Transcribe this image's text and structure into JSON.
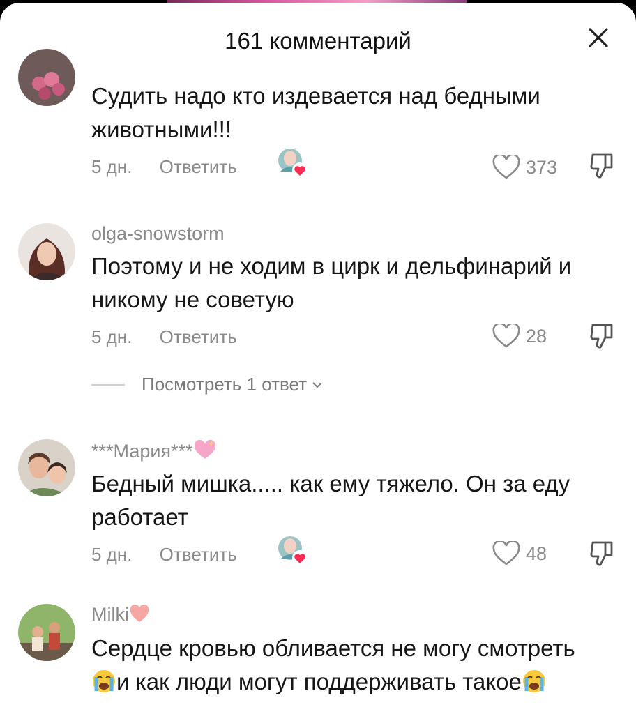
{
  "header": {
    "title": "161 комментарий"
  },
  "comments": [
    {
      "username": "",
      "text": "Судить надо кто издевается над бедными животными!!!",
      "time": "5 дн.",
      "reply": "Ответить",
      "likes": "373",
      "creator_liked": true
    },
    {
      "username": "olga-snowstorm",
      "text": "Поэтому и не ходим в цирк и дельфинарий и никому не советую",
      "time": "5 дн.",
      "reply": "Ответить",
      "likes": "28",
      "creator_liked": false,
      "view_replies": "Посмотреть 1 ответ"
    },
    {
      "username": "***Мария***",
      "username_emoji": "sparkling-heart",
      "text": "Бедный мишка..... как ему тяжело. Он за еду работает",
      "time": "5 дн.",
      "reply": "Ответить",
      "likes": "48",
      "creator_liked": true
    },
    {
      "username": "Milki",
      "username_emoji": "pink-heart",
      "text_part1": "Сердце кровью обливается не могу смотреть",
      "text_part2": "и как люди могут поддерживать такое"
    }
  ],
  "colors": {
    "muted": "#8a8a8a",
    "text": "#161616",
    "heart_badge": "#fe2c55"
  }
}
